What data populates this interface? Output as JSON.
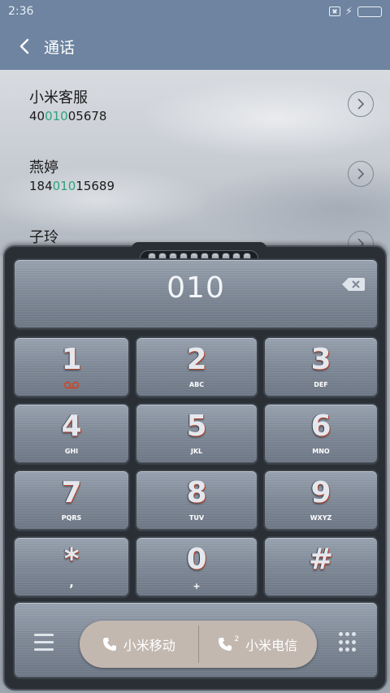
{
  "status": {
    "time": "2:36",
    "icons": [
      "no-sim-icon",
      "charging-bolt-icon",
      "battery-icon"
    ]
  },
  "header": {
    "title": "通话",
    "back_icon": "chevron-left-icon"
  },
  "contacts": [
    {
      "name": "小米客服",
      "number_prefix": "40",
      "number_match": "010",
      "number_suffix": "05678"
    },
    {
      "name": "燕婷",
      "number_prefix": "184",
      "number_match": "010",
      "number_suffix": "15689"
    },
    {
      "name": "子玲"
    }
  ],
  "dialer": {
    "display_number": "010",
    "keys": [
      {
        "digit": "1",
        "letters": ""
      },
      {
        "digit": "2",
        "letters": "ABC"
      },
      {
        "digit": "3",
        "letters": "DEF"
      },
      {
        "digit": "4",
        "letters": "GHI"
      },
      {
        "digit": "5",
        "letters": "JKL"
      },
      {
        "digit": "6",
        "letters": "MNO"
      },
      {
        "digit": "7",
        "letters": "PQRS"
      },
      {
        "digit": "8",
        "letters": "TUV"
      },
      {
        "digit": "9",
        "letters": "WXYZ"
      },
      {
        "digit": "*",
        "letters": ","
      },
      {
        "digit": "0",
        "letters": "+"
      },
      {
        "digit": "#",
        "letters": ""
      }
    ],
    "call_buttons": [
      {
        "label": "小米移动",
        "sim": ""
      },
      {
        "label": "小米电信",
        "sim": "2"
      }
    ]
  },
  "colors": {
    "header_bg": "#6e84a0",
    "match_highlight": "#2fa37d",
    "dialer_bg": "#2a2f36",
    "call_pill": "#c3b8b0"
  }
}
